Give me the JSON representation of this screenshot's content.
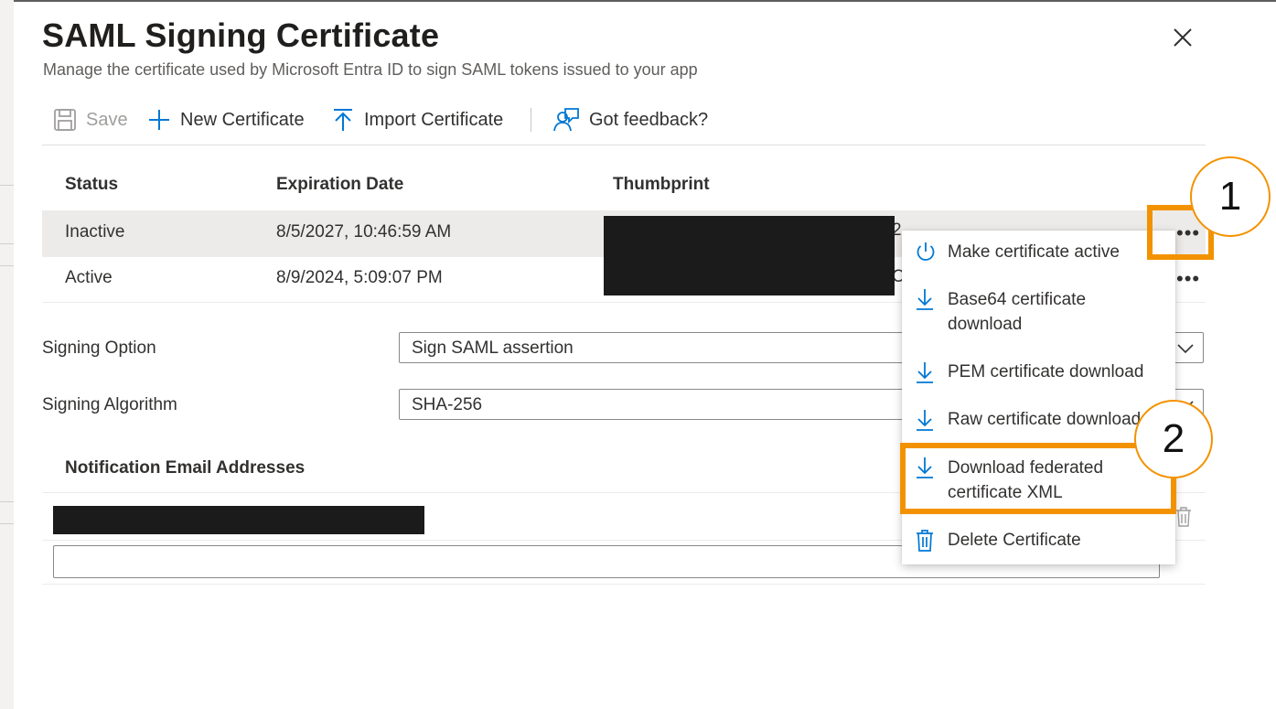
{
  "panel": {
    "title": "SAML Signing Certificate",
    "subtitle": "Manage the certificate used by Microsoft Entra ID to sign SAML tokens issued to your app"
  },
  "toolbar": {
    "save": "Save",
    "new_certificate": "New Certificate",
    "import_certificate": "Import Certificate",
    "feedback": "Got feedback?"
  },
  "table": {
    "headers": {
      "status": "Status",
      "expiration": "Expiration Date",
      "thumbprint": "Thumbprint"
    },
    "rows": [
      {
        "status": "Inactive",
        "expiration": "8/5/2027, 10:46:59 AM",
        "thumbprint_peek": "2",
        "more": "•••"
      },
      {
        "status": "Active",
        "expiration": "8/9/2024, 5:09:07 PM",
        "thumbprint_peek": "C",
        "more": "•••"
      }
    ]
  },
  "form": {
    "signing_option": {
      "label": "Signing Option",
      "value": "Sign SAML assertion"
    },
    "signing_algorithm": {
      "label": "Signing Algorithm",
      "value": "SHA-256"
    }
  },
  "notifications": {
    "header": "Notification Email Addresses",
    "input_placeholder": ""
  },
  "context_menu": {
    "items": [
      {
        "label": "Make certificate active",
        "icon": "power-icon"
      },
      {
        "label": "Base64 certificate\ndownload",
        "icon": "download-icon"
      },
      {
        "label": "PEM certificate download",
        "icon": "download-icon"
      },
      {
        "label": "Raw certificate download",
        "icon": "download-icon"
      },
      {
        "label": "Download federated\ncertificate XML",
        "icon": "download-icon"
      },
      {
        "label": "Delete Certificate",
        "icon": "trash-icon"
      }
    ]
  },
  "annotations": {
    "callout_1": "1",
    "callout_2": "2",
    "highlight_color": "#f39200"
  },
  "colors": {
    "accent": "#0078d4",
    "selected_row": "#edebe9",
    "text": "#323130"
  }
}
